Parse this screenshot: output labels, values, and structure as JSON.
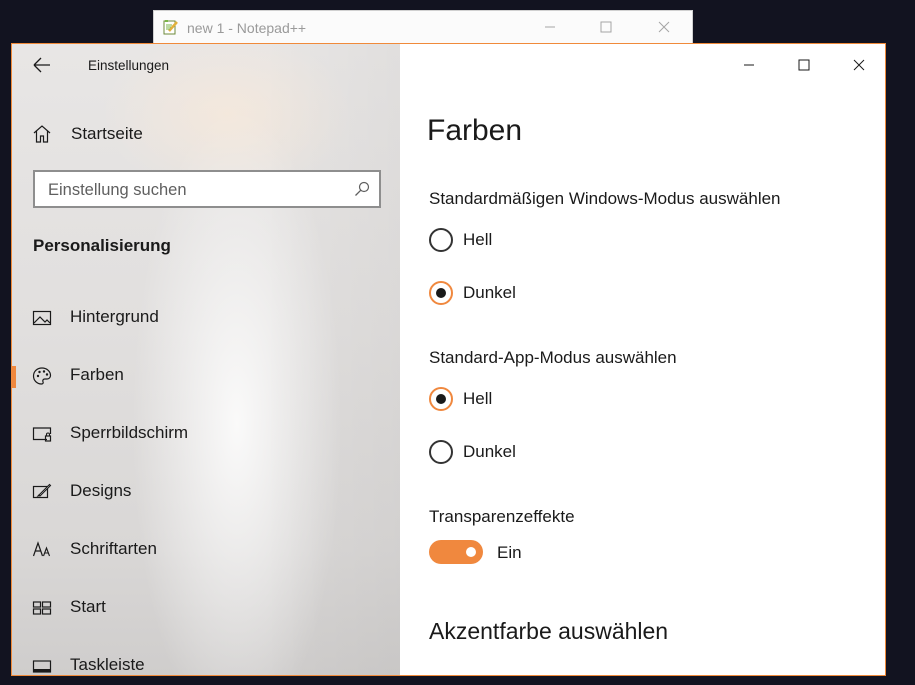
{
  "notepad": {
    "title": "new 1 - Notepad++",
    "icon": "notepad-icon"
  },
  "window": {
    "app_title": "Einstellungen",
    "accent": "#f0883e"
  },
  "sidebar": {
    "home_label": "Startseite",
    "search_placeholder": "Einstellung suchen",
    "section_title": "Personalisierung",
    "items": [
      {
        "label": "Hintergrund",
        "icon": "image-icon",
        "selected": false
      },
      {
        "label": "Farben",
        "icon": "palette-icon",
        "selected": true
      },
      {
        "label": "Sperrbildschirm",
        "icon": "lockscreen-icon",
        "selected": false
      },
      {
        "label": "Designs",
        "icon": "brush-icon",
        "selected": false
      },
      {
        "label": "Schriftarten",
        "icon": "font-icon",
        "selected": false
      },
      {
        "label": "Start",
        "icon": "start-icon",
        "selected": false
      },
      {
        "label": "Taskleiste",
        "icon": "taskbar-icon",
        "selected": false
      }
    ]
  },
  "main": {
    "title": "Farben",
    "windows_mode": {
      "heading": "Standardmäßigen Windows-Modus auswählen",
      "options": [
        {
          "label": "Hell",
          "selected": false
        },
        {
          "label": "Dunkel",
          "selected": true
        }
      ]
    },
    "app_mode": {
      "heading": "Standard-App-Modus auswählen",
      "options": [
        {
          "label": "Hell",
          "selected": true
        },
        {
          "label": "Dunkel",
          "selected": false
        }
      ]
    },
    "transparency": {
      "heading": "Transparenzeffekte",
      "state_label": "Ein",
      "on": true
    },
    "accent_heading": "Akzentfarbe auswählen"
  }
}
